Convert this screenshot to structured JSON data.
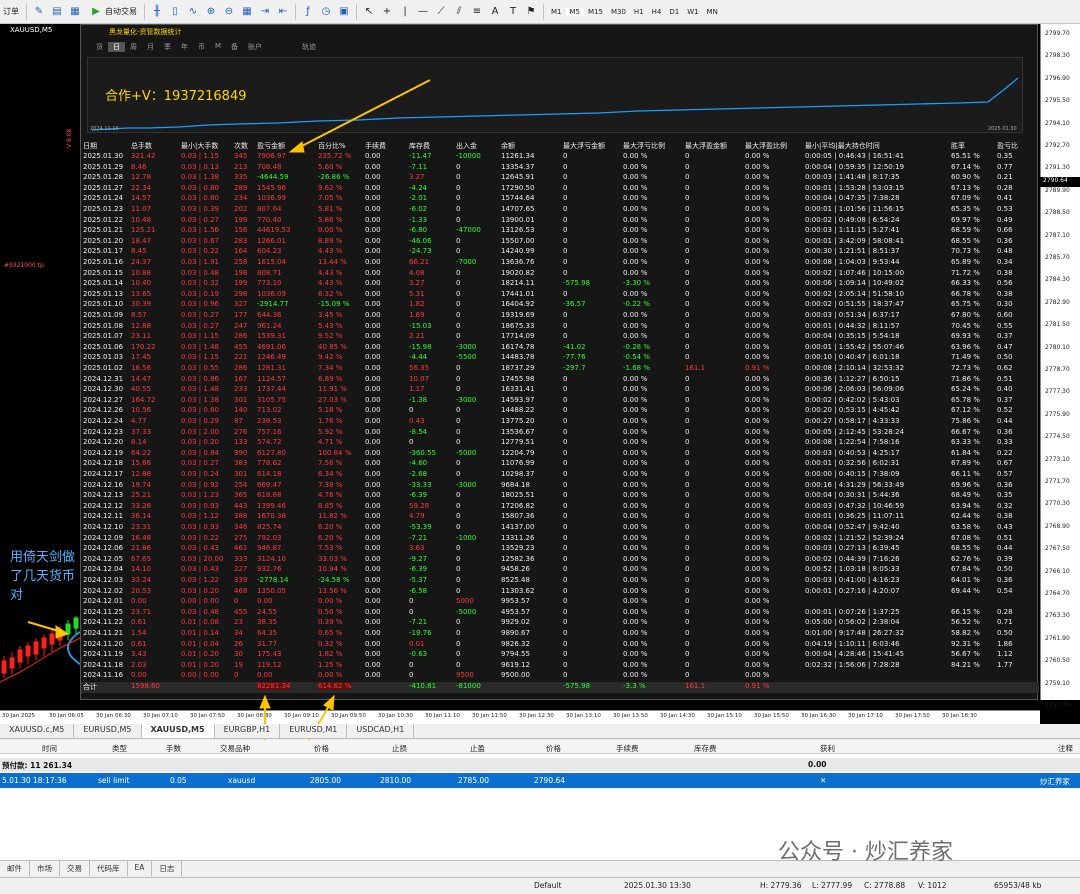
{
  "toolbar": {
    "menu": "订单",
    "auto_trade": "自动交易",
    "timeframes": [
      "M1",
      "M5",
      "M15",
      "M30",
      "H1",
      "H4",
      "D1",
      "W1",
      "MN"
    ]
  },
  "chart": {
    "title": "XAUUSD,M5",
    "left_indicator": "V 8.08",
    "order_line": "#9321000 tp",
    "price_ticks": [
      "2799.70",
      "2798.30",
      "2796.90",
      "2795.50",
      "2794.10",
      "2792.70",
      "2791.30",
      "2789.90",
      "2788.50",
      "2787.10",
      "2785.70",
      "2784.30",
      "2782.90",
      "2781.50",
      "2780.10",
      "2778.70",
      "2777.30",
      "2775.90",
      "2774.50",
      "2773.10",
      "2771.70",
      "2770.30",
      "2768.90",
      "2767.50",
      "2766.10",
      "2764.70",
      "2763.30",
      "2761.90",
      "2760.50",
      "2759.10",
      "2757.70"
    ],
    "current_price": "2790.64",
    "time_ticks": [
      "30 Jan 2025",
      "30 Jan 06:05",
      "30 Jan 06:30",
      "30 Jan 07:10",
      "30 Jan 07:50",
      "30 Jan 08:30",
      "30 Jan 09:10",
      "30 Jan 09:50",
      "30 Jan 10:30",
      "30 Jan 11:10",
      "30 Jan 11:50",
      "30 Jan 12:30",
      "30 Jan 13:10",
      "30 Jan 13:50",
      "30 Jan 14:30",
      "30 Jan 15:10",
      "30 Jan 15:50",
      "30 Jan 16:30",
      "30 Jan 17:10",
      "30 Jan 17:50",
      "30 Jan 18:30"
    ]
  },
  "panel": {
    "title": "黑龙量化-资管数据统计",
    "tabs": [
      "货",
      "日",
      "周",
      "月",
      "季",
      "年",
      "币",
      "M",
      "备",
      "账户",
      "轨迹"
    ],
    "equity_start": "2024.11.16",
    "equity_end": "2025.01.30",
    "contact": "合作+V：1937216849"
  },
  "stats": {
    "headers": [
      "日期",
      "总手数",
      "最小|大手数",
      "次数",
      "盈亏金额",
      "百分比%",
      "手续费",
      "库存费",
      "出入金",
      "余额",
      "最大浮亏金额",
      "最大浮亏比例",
      "最大浮盈金额",
      "最大浮盈比例",
      "最小|平均|最大持仓时间",
      "胜率",
      "盈亏比"
    ],
    "rows": [
      [
        "2025.01.30",
        "321.42",
        "0.03 | 1.15",
        "345",
        "7906.97",
        "235.72 %",
        "0.00",
        "-11.47",
        "-10000",
        "11261.34",
        "0",
        "0.00 %",
        "0",
        "0.00 %",
        "0:00:05 | 0:46:43 | 16:51:41",
        "65.51 %",
        "0.35"
      ],
      [
        "2025.01.29",
        "8.46",
        "0.03 | 0.13",
        "213",
        "708.48",
        "5.60 %",
        "0.00",
        "-7.11",
        "0",
        "13354.37",
        "0",
        "0.00 %",
        "0",
        "0.00 %",
        "0:00:04 | 0:59:35 | 12:50:19",
        "67.14 %",
        "0.77"
      ],
      [
        "2025.01.28",
        "12.78",
        "0.03 | 1.38",
        "335",
        "-4644.59",
        "-26.86 %",
        "0.00",
        "3.27",
        "0",
        "12645.91",
        "0",
        "0.00 %",
        "0",
        "0.00 %",
        "0:00:03 | 1:41:48 | 8:17:35",
        "60.90 %",
        "0.21"
      ],
      [
        "2025.01.27",
        "22.34",
        "0.03 | 0.80",
        "289",
        "1545.96",
        "9.62 %",
        "0.00",
        "-4.24",
        "0",
        "17290.50",
        "0",
        "0.00 %",
        "0",
        "0.00 %",
        "0:00:01 | 1:53:28 | 53:03:15",
        "67.13 %",
        "0.28"
      ],
      [
        "2025.01.24",
        "14.57",
        "0.03 | 0.80",
        "234",
        "1036.99",
        "7.05 %",
        "0.00",
        "-2.01",
        "0",
        "15744.64",
        "0",
        "0.00 %",
        "0",
        "0.00 %",
        "0:00:04 | 0:47:35 | 7:38:28",
        "67.09 %",
        "0.41"
      ],
      [
        "2025.01.23",
        "11.07",
        "0.03 | 0.39",
        "202",
        "807.64",
        "5.81 %",
        "0.00",
        "-6.02",
        "0",
        "14707.65",
        "0",
        "0.00 %",
        "0",
        "0.00 %",
        "0:00:01 | 1:01:56 | 11:56:15",
        "65.35 %",
        "0.53"
      ],
      [
        "2025.01.22",
        "10.48",
        "0.03 | 0.27",
        "199",
        "770.40",
        "5.86 %",
        "0.00",
        "-1.33",
        "0",
        "13900.01",
        "0",
        "0.00 %",
        "0",
        "0.00 %",
        "0:00:02 | 0:49:08 | 6:54:24",
        "69.97 %",
        "0.49"
      ],
      [
        "2025.01.21",
        "125.21",
        "0.03 | 1.56",
        "156",
        "44619.53",
        "0.00 %",
        "0.00",
        "-6.80",
        "-47000",
        "13126.53",
        "0",
        "0.00 %",
        "0",
        "0.00 %",
        "0:00:03 | 1:11:15 | 5:27:41",
        "68.59 %",
        "0.66"
      ],
      [
        "2025.01.20",
        "18.47",
        "0.03 | 0.67",
        "283",
        "1266.01",
        "8.89 %",
        "0.00",
        "-46.06",
        "0",
        "15507.00",
        "0",
        "0.00 %",
        "0",
        "0.00 %",
        "0:00:01 | 3:42:09 | 58:08:41",
        "68.55 %",
        "0.36"
      ],
      [
        "2025.01.17",
        "8.45",
        "0.03 | 0.22",
        "164",
        "604.23",
        "4.43 %",
        "0.00",
        "-24.73",
        "0",
        "14240.99",
        "0",
        "0.00 %",
        "0",
        "0.00 %",
        "0:00:30 | 1:21:51 | 8:51:37",
        "70.73 %",
        "0.48"
      ],
      [
        "2025.01.16",
        "24.37",
        "0.03 | 1.91",
        "258",
        "1615.04",
        "13.44 %",
        "0.00",
        "66.21",
        "-7000",
        "13636.76",
        "0",
        "0.00 %",
        "0",
        "0.00 %",
        "0:00:08 | 1:04:03 | 9:53:44",
        "65.89 %",
        "0.34"
      ],
      [
        "2025.01.15",
        "10.88",
        "0.03 | 0.48",
        "198",
        "808.71",
        "4.43 %",
        "0.00",
        "4.08",
        "0",
        "19020.82",
        "0",
        "0.00 %",
        "0",
        "0.00 %",
        "0:00:02 | 1:07:46 | 10:15:00",
        "71.72 %",
        "0.38"
      ],
      [
        "2025.01.14",
        "10.40",
        "0.03 | 0.32",
        "199",
        "773.10",
        "4.43 %",
        "0.00",
        "3.27",
        "0",
        "18214.11",
        "-575.98",
        "-3.30 %",
        "0",
        "0.00 %",
        "0:00:06 | 1:09:14 | 10:49:02",
        "66.33 %",
        "0.56"
      ],
      [
        "2025.01.13",
        "13.65",
        "0.03 | 0.19",
        "298",
        "1036.09",
        "6.32 %",
        "0.00",
        "5.31",
        "0",
        "17441.01",
        "0",
        "0.00 %",
        "0",
        "0.00 %",
        "0:00:02 | 2:05:14 | 51:58:10",
        "66.78 %",
        "0.38"
      ],
      [
        "2025.01.10",
        "30.39",
        "0.03 | 0.96",
        "327",
        "-2914.77",
        "-15.09 %",
        "0.00",
        "1.82",
        "0",
        "16404.92",
        "-36.57",
        "-0.22 %",
        "0",
        "0.00 %",
        "0:00:02 | 0:51:55 | 18:37:47",
        "65.75 %",
        "0.30"
      ],
      [
        "2025.01.09",
        "8.57",
        "0.03 | 0.27",
        "177",
        "644.36",
        "3.45 %",
        "0.00",
        "1.69",
        "0",
        "19319.69",
        "0",
        "0.00 %",
        "0",
        "0.00 %",
        "0:00:03 | 0:51:34 | 6:37:17",
        "67.80 %",
        "0.60"
      ],
      [
        "2025.01.08",
        "12.88",
        "0.03 | 0.27",
        "247",
        "961.24",
        "5.43 %",
        "0.00",
        "-15.03",
        "0",
        "18675.33",
        "0",
        "0.00 %",
        "0",
        "0.00 %",
        "0:00:01 | 0:44:32 | 8:11:57",
        "70.45 %",
        "0.55"
      ],
      [
        "2025.01.07",
        "23.11",
        "0.03 | 1.15",
        "286",
        "1539.31",
        "9.52 %",
        "0.00",
        "2.21",
        "0",
        "17714.09",
        "0",
        "0.00 %",
        "0",
        "0.00 %",
        "0:00:04 | 0:35:15 | 5:54:18",
        "69.93 %",
        "0.37"
      ],
      [
        "2025.01.06",
        "170.22",
        "0.03 | 1.48",
        "455",
        "4691.06",
        "40.85 %",
        "0.00",
        "-15.98",
        "-3000",
        "16174.78",
        "-41.02",
        "-0.28 %",
        "0",
        "0.00 %",
        "0:00:01 | 1:55:42 | 55:07:46",
        "63.96 %",
        "0.47"
      ],
      [
        "2025.01.03",
        "17.45",
        "0.03 | 1.15",
        "221",
        "1246.49",
        "9.42 %",
        "0.00",
        "-4.44",
        "-5500",
        "14483.78",
        "-77.76",
        "-0.54 %",
        "0",
        "0.00 %",
        "0:00:10 | 0:40:47 | 6:01:18",
        "71.49 %",
        "0.50"
      ],
      [
        "2025.01.02",
        "16.56",
        "0.03 | 0.55",
        "286",
        "1281.31",
        "7.34 %",
        "0.00",
        "56.35",
        "0",
        "18737.29",
        "-297.7",
        "-1.68 %",
        "161.1",
        "0.91 %",
        "0:00:08 | 2:10:14 | 32:53:32",
        "72.73 %",
        "0.62"
      ],
      [
        "2024.12.31",
        "14.47",
        "0.03 | 0.86",
        "167",
        "1124.57",
        "6.89 %",
        "0.00",
        "10.07",
        "0",
        "17455.98",
        "0",
        "0.00 %",
        "0",
        "0.00 %",
        "0:00:36 | 1:12:27 | 6:50:15",
        "71.86 %",
        "0.51"
      ],
      [
        "2024.12.30",
        "40.55",
        "0.03 | 1.48",
        "233",
        "1737.44",
        "11.91 %",
        "0.00",
        "1.17",
        "0",
        "16331.41",
        "0",
        "0.00 %",
        "0",
        "0.00 %",
        "0:00:06 | 2:06:03 | 56:09:06",
        "65.24 %",
        "0.40"
      ],
      [
        "2024.12.27",
        "164.72",
        "0.03 | 1.38",
        "301",
        "3105.75",
        "27.03 %",
        "0.00",
        "-1.38",
        "-3000",
        "14593.97",
        "0",
        "0.00 %",
        "0",
        "0.00 %",
        "0:00:02 | 0:42:02 | 5:43:03",
        "65.78 %",
        "0.37"
      ],
      [
        "2024.12.26",
        "10.56",
        "0.03 | 0.60",
        "140",
        "713.02",
        "5.18 %",
        "0.00",
        "0",
        "0",
        "14488.22",
        "0",
        "0.00 %",
        "0",
        "0.00 %",
        "0:00:20 | 0:53:15 | 4:45:42",
        "67.12 %",
        "0.52"
      ],
      [
        "2024.12.24",
        "4.77",
        "0.03 | 0.29",
        "87",
        "236.53",
        "1.76 %",
        "0.00",
        "0.43",
        "0",
        "13775.20",
        "0",
        "0.00 %",
        "0",
        "0.00 %",
        "0:00:27 | 0:58:17 | 4:33:33",
        "75.86 %",
        "0.44"
      ],
      [
        "2024.12.23",
        "37.33",
        "0.03 | 2.00",
        "276",
        "757.16",
        "5.92 %",
        "0.00",
        "-8.54",
        "0",
        "13536.67",
        "0",
        "0.00 %",
        "0",
        "0.00 %",
        "0:00:05 | 2:12:45 | 53:28:24",
        "66.67 %",
        "0.36"
      ],
      [
        "2024.12.20",
        "8.14",
        "0.03 | 0.20",
        "133",
        "574.72",
        "4.71 %",
        "0.00",
        "0",
        "0",
        "12779.51",
        "0",
        "0.00 %",
        "0",
        "0.00 %",
        "0:00:08 | 1:22:54 | 7:58:16",
        "63.33 %",
        "0.33"
      ],
      [
        "2024.12.19",
        "64.22",
        "0.03 | 0.84",
        "390",
        "6127.80",
        "100.84 %",
        "0.00",
        "-360.55",
        "-5000",
        "12204.79",
        "0",
        "0.00 %",
        "0",
        "0.00 %",
        "0:00:03 | 0:40:53 | 4:25:17",
        "61.84 %",
        "0.22"
      ],
      [
        "2024.12.18",
        "15.66",
        "0.03 | 0.27",
        "383",
        "778.62",
        "7.56 %",
        "0.00",
        "-4.60",
        "0",
        "11076.99",
        "0",
        "0.00 %",
        "0",
        "0.00 %",
        "0:00:01 | 0:32:56 | 6:02:31",
        "67.89 %",
        "0.67"
      ],
      [
        "2024.12.17",
        "12.88",
        "0.03 | 0.24",
        "301",
        "614.18",
        "6.34 %",
        "0.00",
        "-2.68",
        "0",
        "10298.37",
        "0",
        "0.00 %",
        "0",
        "0.00 %",
        "0:00:00 | 0:40:15 | 7:38:09",
        "66.11 %",
        "0.57"
      ],
      [
        "2024.12.16",
        "19.74",
        "0.03 | 0.92",
        "254",
        "669.47",
        "7.38 %",
        "0.00",
        "-33.33",
        "-3000",
        "9684.18",
        "0",
        "0.00 %",
        "0",
        "0.00 %",
        "0:00:16 | 4:31:29 | 56:33:49",
        "69.96 %",
        "0.36"
      ],
      [
        "2024.12.13",
        "25.21",
        "0.03 | 1.23",
        "365",
        "618.68",
        "4.76 %",
        "0.00",
        "-6.39",
        "0",
        "18025.51",
        "0",
        "0.00 %",
        "0",
        "0.00 %",
        "0:00:04 | 0:30:31 | 5:44:36",
        "68.49 %",
        "0.35"
      ],
      [
        "2024.12.12",
        "33.28",
        "0.03 | 0.93",
        "443",
        "1399.46",
        "8.85 %",
        "0.00",
        "59.28",
        "0",
        "17206.82",
        "0",
        "0.00 %",
        "0",
        "0.00 %",
        "0:00:03 | 0:47:32 | 10:46:59",
        "63.94 %",
        "0.32"
      ],
      [
        "2024.12.11",
        "36.14",
        "0.03 | 1.12",
        "388",
        "1670.38",
        "11.82 %",
        "0.00",
        "4.79",
        "0",
        "15807.36",
        "0",
        "0.00 %",
        "0",
        "0.00 %",
        "0:00:01 | 0:36:25 | 11:07:11",
        "62.44 %",
        "0.38"
      ],
      [
        "2024.12.10",
        "23.31",
        "0.03 | 0.93",
        "346",
        "825.74",
        "6.20 %",
        "0.00",
        "-53.39",
        "0",
        "14137.00",
        "0",
        "0.00 %",
        "0",
        "0.00 %",
        "0:00:04 | 0:52:47 | 9:42:40",
        "63.58 %",
        "0.43"
      ],
      [
        "2024.12.09",
        "16.48",
        "0.03 | 0.22",
        "275",
        "792.03",
        "6.20 %",
        "0.00",
        "-7.21",
        "-1000",
        "13311.26",
        "0",
        "0.00 %",
        "0",
        "0.00 %",
        "0:00:02 | 1:21:52 | 52:39:24",
        "67.08 %",
        "0.51"
      ],
      [
        "2024.12.06",
        "21.86",
        "0.03 | 0.43",
        "461",
        "946.87",
        "7.53 %",
        "0.00",
        "3.63",
        "0",
        "13529.23",
        "0",
        "0.00 %",
        "0",
        "0.00 %",
        "0:00:03 | 0:27:13 | 6:39:45",
        "68.55 %",
        "0.44"
      ],
      [
        "2024.12.05",
        "67.65",
        "0.03 | 20.00",
        "333",
        "3124.10",
        "33.03 %",
        "0.00",
        "-9.27",
        "0",
        "12582.36",
        "0",
        "0.00 %",
        "0",
        "0.00 %",
        "0:00:02 | 0:44:39 | 7:16:26",
        "62.76 %",
        "0.39"
      ],
      [
        "2024.12.04",
        "14.10",
        "0.03 | 0.43",
        "227",
        "932.76",
        "10.94 %",
        "0.00",
        "-6.39",
        "0",
        "9458.26",
        "0",
        "0.00 %",
        "0",
        "0.00 %",
        "0:00:52 | 1:03:18 | 8:05:33",
        "67.84 %",
        "0.50"
      ],
      [
        "2024.12.03",
        "33.24",
        "0.03 | 1.22",
        "339",
        "-2778.14",
        "-24.58 %",
        "0.00",
        "-5.37",
        "0",
        "8525.48",
        "0",
        "0.00 %",
        "0",
        "0.00 %",
        "0:00:03 | 0:41:00 | 4:16:23",
        "64.01 %",
        "0.36"
      ],
      [
        "2024.12.02",
        "20.53",
        "0.03 | 0.20",
        "468",
        "1350.05",
        "13.56 %",
        "0.00",
        "-6.58",
        "0",
        "11303.62",
        "0",
        "0.00 %",
        "0",
        "0.00 %",
        "0:00:01 | 0:27:16 | 4:20:07",
        "69.44 %",
        "0.54"
      ],
      [
        "2024.12.01",
        "0.00",
        "0.00 | 0.00",
        "0",
        "0.00",
        "0.00 %",
        "0.00",
        "0",
        "5000",
        "9953.57",
        "0",
        "0.00 %",
        "0",
        "0.00 %",
        "",
        "",
        ""
      ],
      [
        "2024.11.25",
        "23.71",
        "0.03 | 0.48",
        "455",
        "24.55",
        "0.50 %",
        "0.00",
        "0",
        "-5000",
        "4953.57",
        "0",
        "0.00 %",
        "0",
        "0.00 %",
        "0:00:01 | 0:07:26 | 1:37:25",
        "66.15 %",
        "0.28"
      ],
      [
        "2024.11.22",
        "0.61",
        "0.01 | 0.08",
        "23",
        "38.35",
        "0.39 %",
        "0.00",
        "-7.21",
        "0",
        "9929.02",
        "0",
        "0.00 %",
        "0",
        "0.00 %",
        "0:05:00 | 0:56:02 | 2:38:04",
        "56.52 %",
        "0.71"
      ],
      [
        "2024.11.21",
        "1.54",
        "0.01 | 0.14",
        "34",
        "64.35",
        "0.65 %",
        "0.00",
        "-19.76",
        "0",
        "9890.67",
        "0",
        "0.00 %",
        "0",
        "0.00 %",
        "0:01:00 | 9:17:48 | 26:27:32",
        "58.82 %",
        "0.50"
      ],
      [
        "2024.11.20",
        "0.61",
        "0.01 | 0.04",
        "26",
        "31.77",
        "0.32 %",
        "0.00",
        "0.01",
        "0",
        "9826.32",
        "0",
        "0.00 %",
        "0",
        "0.00 %",
        "0:04:19 | 1:10:11 | 6:03:46",
        "92.31 %",
        "1.86"
      ],
      [
        "2024.11.19",
        "3.43",
        "0.01 | 0.20",
        "30",
        "175.43",
        "1.82 %",
        "0.00",
        "-0.63",
        "0",
        "9794.55",
        "0",
        "0.00 %",
        "0",
        "0.00 %",
        "0:00:04 | 4:28:46 | 15:41:45",
        "56.67 %",
        "1.12"
      ],
      [
        "2024.11.18",
        "2.03",
        "0.01 | 0.20",
        "19",
        "119.12",
        "1.25 %",
        "0.00",
        "0",
        "0",
        "9619.12",
        "0",
        "0.00 %",
        "0",
        "0.00 %",
        "0:02:32 | 1:56:06 | 7:28:28",
        "84.21 %",
        "1.77"
      ],
      [
        "2024.11.16",
        "0.00",
        "0.00 | 0.00",
        "0",
        "0.00",
        "0.00 %",
        "0.00",
        "0",
        "9500",
        "9500.00",
        "0",
        "0.00 %",
        "0",
        "0.00 %",
        "",
        "",
        ""
      ]
    ],
    "total": {
      "label": "合计",
      "lots": "1598.60",
      "profit": "82281.34",
      "percent": "614.62 %",
      "swap": "-410.81",
      "deposit": "-81000",
      "max_float_loss": "-575.98",
      "max_float_loss_pct": "-3.3 %",
      "max_float_profit": "161.1",
      "max_float_profit_pct": "0.91 %"
    }
  },
  "annotations": {
    "note": "用倚天剑做了几天货币对"
  },
  "symbol_tabs": [
    "XAUUSD.c,M5",
    "EURUSD,M5",
    "XAUUSD,M5",
    "EURGBP,H1",
    "EURUSD,M1",
    "USDCAD,H1"
  ],
  "trade": {
    "headers": [
      "时间",
      "类型",
      "手数",
      "交易品种",
      "价格",
      "止损",
      "止盈",
      "价格",
      "手续费",
      "库存费",
      "获利",
      "注释"
    ],
    "balance_label": "预付款: 11 261.34",
    "balance_profit": "0.00",
    "order": [
      "5.01.30 18:17:36",
      "sell limit",
      "0.05",
      "xauusd",
      "2805.00",
      "2810.00",
      "2785.00",
      "2790.64",
      "",
      "",
      "",
      "炒汇养家"
    ]
  },
  "bottom_tabs": [
    "邮件",
    "市场",
    "交易",
    "代码库",
    "EA",
    "日志"
  ],
  "status": {
    "profile": "Default",
    "datetime": "2025.01.30 13:30",
    "high": "H: 2779.36",
    "low": "L: 2777.99",
    "close": "C: 2778.88",
    "volume": "V: 1012",
    "traffic": "65953/48 kb"
  },
  "watermark": "公众号 · 炒汇养家"
}
